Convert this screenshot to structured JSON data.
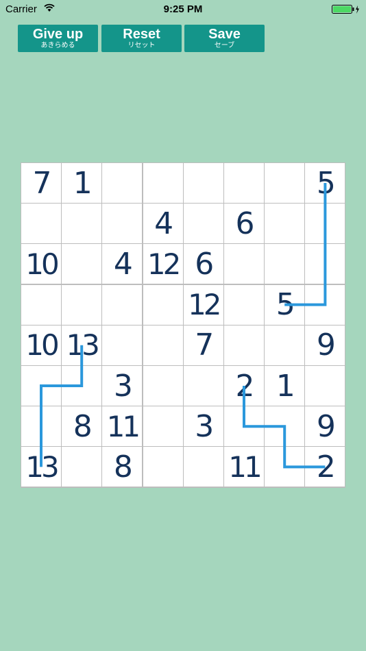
{
  "status_bar": {
    "carrier": "Carrier",
    "time": "9:25 PM"
  },
  "toolbar": {
    "give_up_label": "Give up",
    "give_up_sub": "あきらめる",
    "reset_label": "Reset",
    "reset_sub": "リセット",
    "save_label": "Save",
    "save_sub": "セーブ"
  },
  "colors": {
    "background": "#a5d6bd",
    "button": "#14958a",
    "number": "#15325a",
    "path": "#2b98dc"
  },
  "board": {
    "rows": 8,
    "cols": 8,
    "cells": [
      [
        "7",
        "1",
        "",
        "",
        "",
        "",
        "",
        "5"
      ],
      [
        "",
        "",
        "",
        "4",
        "",
        "6",
        "",
        ""
      ],
      [
        "10",
        "",
        "4",
        "12",
        "6",
        "",
        "",
        ""
      ],
      [
        "",
        "",
        "",
        "",
        "12",
        "",
        "5",
        ""
      ],
      [
        "10",
        "13",
        "",
        "",
        "7",
        "",
        "",
        "9"
      ],
      [
        "",
        "",
        "3",
        "",
        "",
        "2",
        "1",
        ""
      ],
      [
        "",
        "8",
        "11",
        "",
        "3",
        "",
        "",
        "9"
      ],
      [
        "13",
        "",
        "8",
        "",
        "",
        "11",
        "",
        "2"
      ]
    ],
    "paths": [
      {
        "value": "5",
        "cells": [
          [
            0,
            7
          ],
          [
            1,
            7
          ],
          [
            2,
            7
          ],
          [
            3,
            7
          ],
          [
            3,
            6
          ]
        ]
      },
      {
        "value": "13",
        "cells": [
          [
            4,
            1
          ],
          [
            5,
            1
          ],
          [
            5,
            0
          ],
          [
            6,
            0
          ],
          [
            7,
            0
          ]
        ]
      },
      {
        "value": "2",
        "cells": [
          [
            5,
            5
          ],
          [
            6,
            5
          ],
          [
            6,
            6
          ],
          [
            7,
            6
          ],
          [
            7,
            7
          ]
        ]
      }
    ]
  }
}
